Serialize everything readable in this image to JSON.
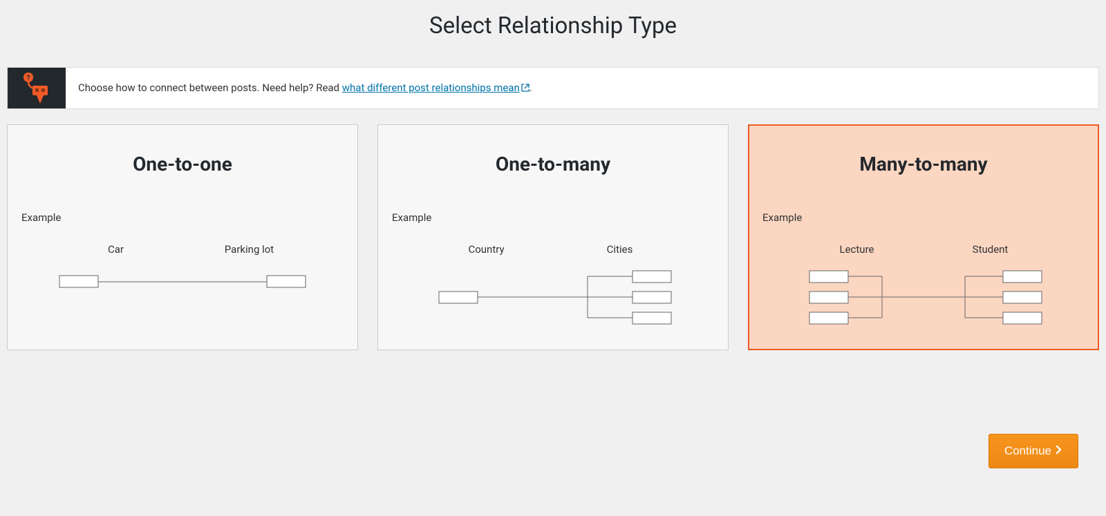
{
  "page_title": "Select Relationship Type",
  "help": {
    "text_before": "Choose how to connect between posts. Need help? Read ",
    "link_text": "what different post relationships mean",
    "text_after": "."
  },
  "cards": [
    {
      "title": "One-to-one",
      "example_label": "Example",
      "left_label": "Car",
      "right_label": "Parking lot",
      "selected": false
    },
    {
      "title": "One-to-many",
      "example_label": "Example",
      "left_label": "Country",
      "right_label": "Cities",
      "selected": false
    },
    {
      "title": "Many-to-many",
      "example_label": "Example",
      "left_label": "Lecture",
      "right_label": "Student",
      "selected": true
    }
  ],
  "continue_label": "Continue"
}
